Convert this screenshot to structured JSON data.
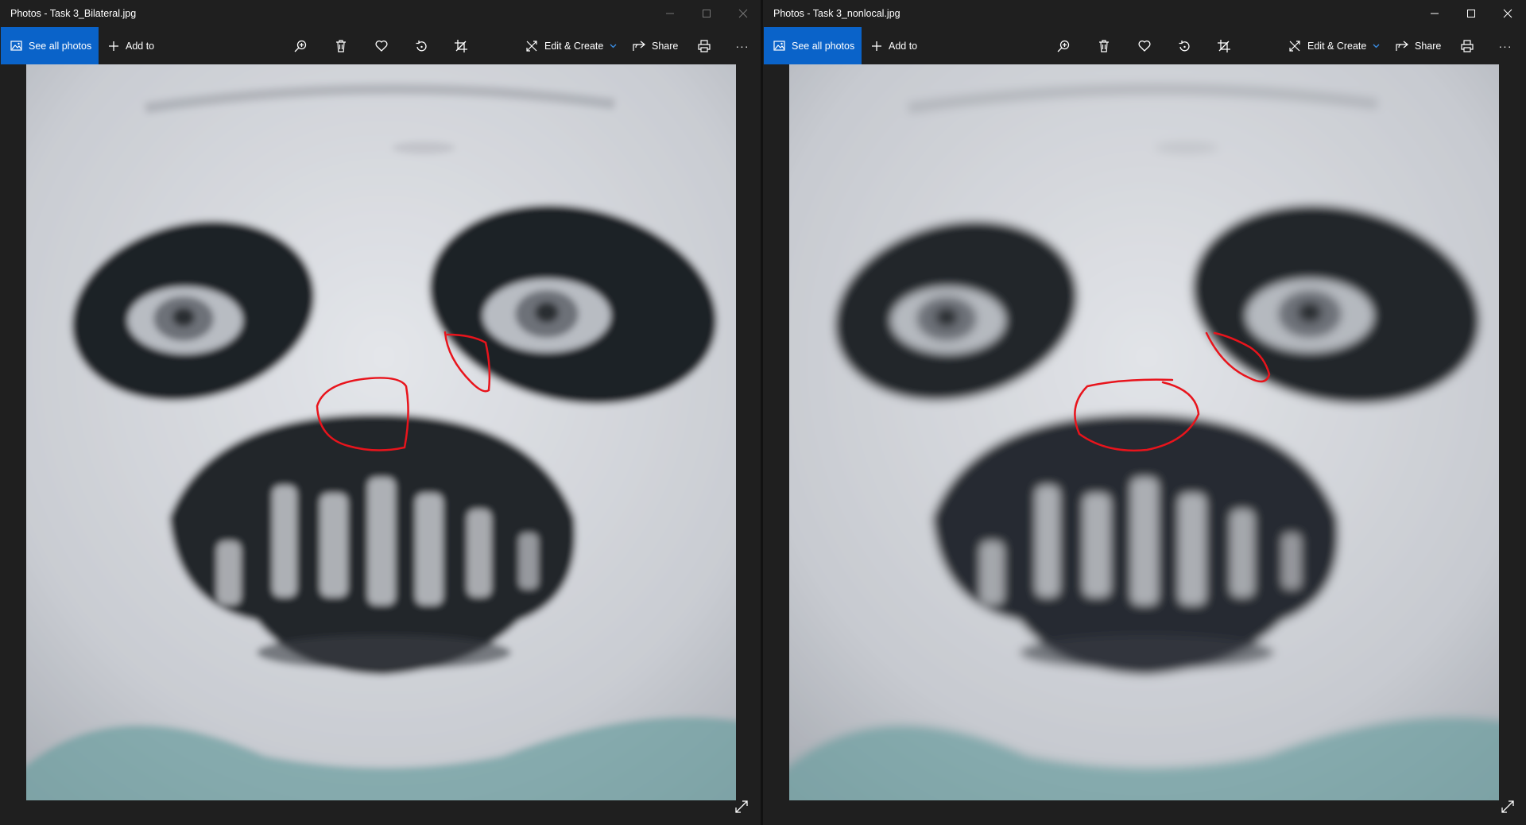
{
  "windows": [
    {
      "title": "Photos - Task 3_Bilateral.jpg",
      "toolbar": {
        "see_all": "See all photos",
        "add_to": "Add to",
        "edit_create": "Edit & Create",
        "share": "Share",
        "more": "···"
      },
      "controls": {
        "min": "minimize-icon",
        "max": "maximize-icon",
        "close": "close-icon"
      },
      "photo": {
        "description_icon": "panda-face-closeup",
        "blur": 4.2
      }
    },
    {
      "title": "Photos - Task 3_nonlocal.jpg",
      "toolbar": {
        "see_all": "See all photos",
        "add_to": "Add to",
        "edit_create": "Edit & Create",
        "share": "Share",
        "more": "···"
      },
      "controls": {
        "min": "minimize-icon",
        "max": "maximize-icon",
        "close": "close-icon"
      },
      "photo": {
        "description_icon": "panda-face-closeup",
        "blur": 5.8
      }
    }
  ],
  "colors": {
    "accent": "#0a63c9",
    "annotation": "#e8141c",
    "window_bg": "#1f1f1f"
  }
}
